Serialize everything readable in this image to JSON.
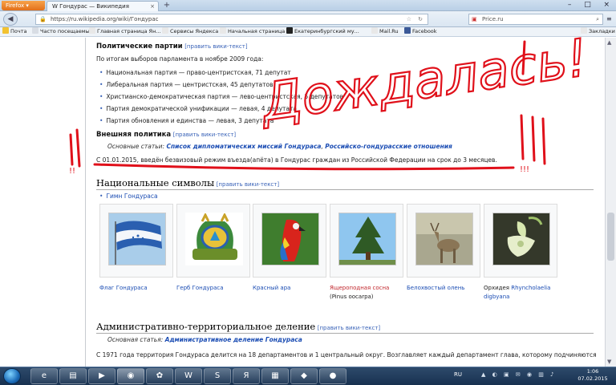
{
  "browser": {
    "app_button": "Firefox",
    "tab_title": "Гондурас — Википедия",
    "url": "https://ru.wikipedia.org/wiki/Гондурас",
    "search_engine": "Price.ru",
    "bookmarks": [
      {
        "label": "Почта",
        "color": "#f2c230"
      },
      {
        "label": "Часто посещаемые",
        "color": "#d8dde4"
      },
      {
        "label": "Главная страница Ян...",
        "color": "#e8e8e8"
      },
      {
        "label": "Сервисы Яндекса",
        "color": "#e8e8e8"
      },
      {
        "label": "Начальная страница",
        "color": "#e8e8e8"
      },
      {
        "label": "Екатеринбургский му...",
        "color": "#222222"
      },
      {
        "label": "Mail.Ru",
        "color": "#e8e8e8"
      },
      {
        "label": "Facebook",
        "color": "#3b5998"
      }
    ],
    "bookmarks_right": "Закладки"
  },
  "article": {
    "parties": {
      "heading": "Политические партии",
      "edit": "[править вики-текст]",
      "intro": "По итогам выборов парламента в ноябре 2009 года:",
      "items": [
        "Национальная партия — право-центристская, 71 депутат",
        "Либеральная партия — центристская, 45 депутатов",
        "Христианско-демократическая партия — лево-центристская, 5 депутатов",
        "Партия демократической унификации — левая, 4 депутата",
        "Партия обновления и единства — левая, 3 депутата"
      ]
    },
    "foreign": {
      "heading": "Внешняя политика",
      "edit": "[править вики-текст]",
      "main_prefix": "Основные статьи:",
      "main_link1": "Список дипломатических миссий Гондураса",
      "main_sep": ",",
      "main_link2": "Российско-гондурасские отношения",
      "note": "С 01.01.2015, введён безвизовый режим въезда(апёта) в Гондурас граждан из Российской Федерации на срок до 3 месяцев."
    },
    "symbols": {
      "heading": "Национальные символы",
      "edit": "[править вики-текст]",
      "anthem": "Гимн Гондураса",
      "gallery": [
        {
          "caption": "Флаг Гондураса",
          "sub": "",
          "red": false
        },
        {
          "caption": "Герб Гондураса",
          "sub": "",
          "red": false
        },
        {
          "caption": "Красный ара",
          "sub": "",
          "red": false
        },
        {
          "caption": "Ящероподная сосна",
          "sub": "(Pinus oocarpa)",
          "red": true
        },
        {
          "caption": "Белохвостый олень",
          "sub": "",
          "red": false
        },
        {
          "caption_plain": "Орхидея",
          "caption": "Rhyncholaelia",
          "sub": "digbyana",
          "red": false
        }
      ]
    },
    "admin": {
      "heading": "Административно-территориальное деление",
      "edit": "[править вики-текст]",
      "main_prefix": "Основная статья:",
      "main_link": "Административное деление Гондураса",
      "text": "С 1971 года территория Гондураса делится на 18 департаментов и 1 центральный округ. Возглавляет каждый департамент глава, которому подчиняются"
    }
  },
  "annotation": {
    "handwriting": "Дождалась!",
    "marks_left": "!!",
    "marks_right": "!!!",
    "ink_color": "#e0101a"
  },
  "taskbar": {
    "lang": "RU",
    "time": "1:06",
    "date": "07.02.2015"
  }
}
